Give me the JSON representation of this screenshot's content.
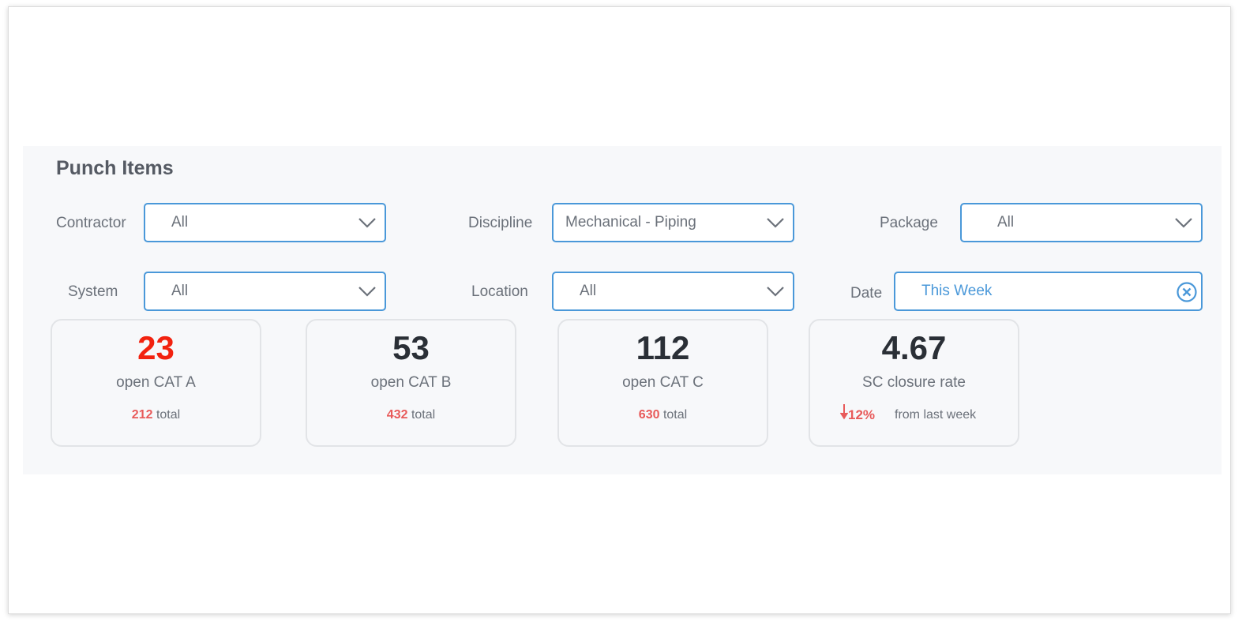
{
  "section": {
    "title": "Punch Items"
  },
  "filters": {
    "contractor": {
      "label": "Contractor",
      "value": "All"
    },
    "discipline": {
      "label": "Discipline",
      "value": "Mechanical - Piping"
    },
    "package": {
      "label": "Package",
      "value": "All"
    },
    "system": {
      "label": "System",
      "value": "All"
    },
    "location": {
      "label": "Location",
      "value": "All"
    },
    "date": {
      "label": "Date",
      "value": "This Week"
    }
  },
  "cards": [
    {
      "value": "23",
      "label": "open CAT A",
      "total": "212",
      "total_suffix": "total"
    },
    {
      "value": "53",
      "label": "open CAT B",
      "total": "432",
      "total_suffix": "total"
    },
    {
      "value": "112",
      "label": "open CAT C",
      "total": "630",
      "total_suffix": "total"
    },
    {
      "value": "4.67",
      "label": "SC closure rate",
      "change": "12%",
      "change_suffix": "from last week"
    }
  ],
  "colors": {
    "accent": "#4a98d9",
    "alert": "#f2220f",
    "total": "#e85a5a"
  }
}
